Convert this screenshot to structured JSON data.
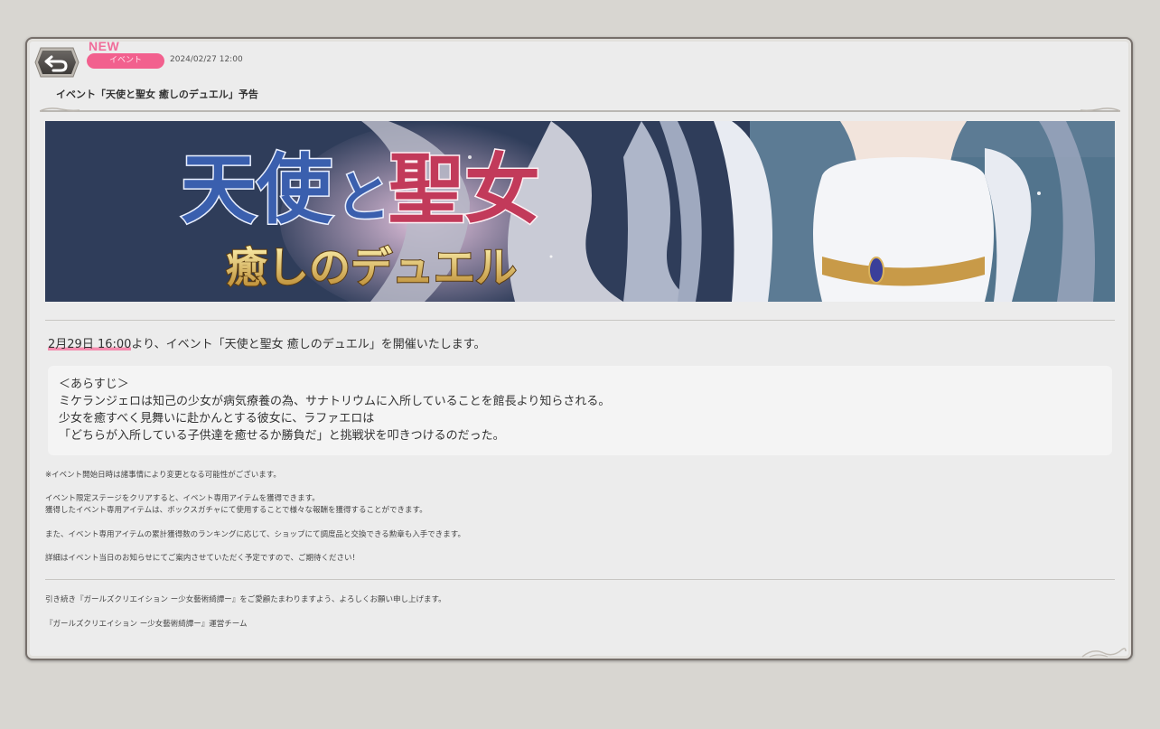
{
  "header": {
    "new_label": "NEW",
    "category": "イベント",
    "date": "2024/02/27 12:00",
    "title": "イベント「天使と聖女 癒しのデュエル」予告"
  },
  "banner": {
    "logo_line1a": "天使",
    "logo_line1b": "と",
    "logo_line1c": "聖女",
    "logo_line2": "癒しのデュエル"
  },
  "body": {
    "intro_highlight": "2月29日 16:00",
    "intro_rest": "より、イベント「天使と聖女 癒しのデュエル」を開催いたします。",
    "synopsis": [
      "＜あらすじ＞",
      "ミケランジェロは知己の少女が病気療養の為、サナトリウムに入所していることを館長より知らされる。",
      "少女を癒すべく見舞いに赴かんとする彼女に、ラファエロは",
      "「どちらが入所している子供達を癒せるか勝負だ」と挑戦状を叩きつけるのだった。"
    ],
    "note1": "※イベント開始日時は諸事情により変更となる可能性がございます。",
    "note2a": "イベント限定ステージをクリアすると、イベント専用アイテムを獲得できます。",
    "note2b": "獲得したイベント専用アイテムは、ボックスガチャにて使用することで様々な報酬を獲得することができます。",
    "note3": "また、イベント専用アイテムの累計獲得数のランキングに応じて、ショップにて調度品と交換できる勲章も入手できます。",
    "note4": "詳細はイベント当日のお知らせにてご案内させていただく予定ですので、ご期待ください！",
    "closing": "引き続き『ガールズクリエイション ー少女藝術綺譚ー』をご愛顧たまわりますよう、よろしくお願い申し上げます。",
    "signature": "『ガールズクリエイション ー少女藝術綺譚ー』運営チーム"
  },
  "colors": {
    "accent_pink": "#f2608e",
    "panel_bg": "#ececec",
    "panel_border": "#77706b",
    "page_bg": "#d8d6d1"
  },
  "icons": {
    "back": "back-arrow-icon"
  }
}
